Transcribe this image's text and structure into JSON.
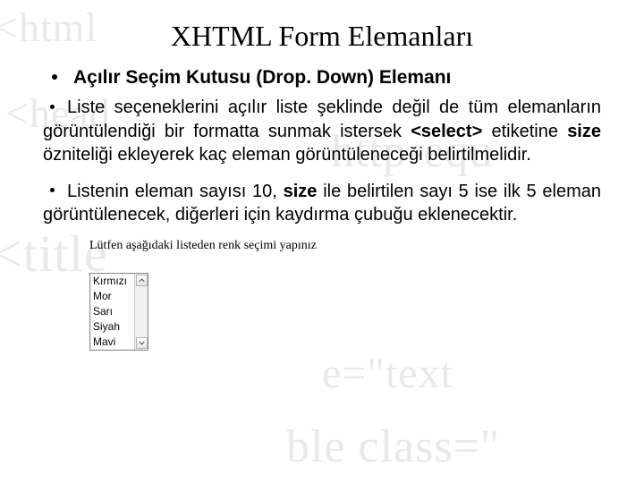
{
  "title": "XHTML Form Elemanları",
  "bullet1": "Açılır Seçim Kutusu (Drop. Down) Elemanı",
  "para1_a": "Liste seçeneklerini açılır liste şeklinde değil de tüm elemanların görüntülendiği bir formatta sunmak istersek ",
  "para1_tag": "<select>",
  "para1_b": " etiketine ",
  "para1_size": "size",
  "para1_c": " özniteliği ekleyerek kaç eleman görüntüleneceği belirtilmelidir.",
  "para2_a": "Listenin eleman sayısı 10, ",
  "para2_size": "size",
  "para2_b": " ile belirtilen sayı 5 ise ilk 5 eleman görüntülenecek, diğerleri için kaydırma çubuğu eklenecektir.",
  "figure": {
    "prompt": "Lütfen aşağıdaki listeden renk seçimi yapınız",
    "items": [
      "Kırmızı",
      "Mor",
      "Sarı",
      "Siyah",
      "Mavi"
    ]
  },
  "bg": {
    "l1": "<html",
    "l2": "<head",
    "l3": "http-equ",
    "l4": "<title",
    "l5": "e=\"text",
    "l6": "ble class=\""
  }
}
